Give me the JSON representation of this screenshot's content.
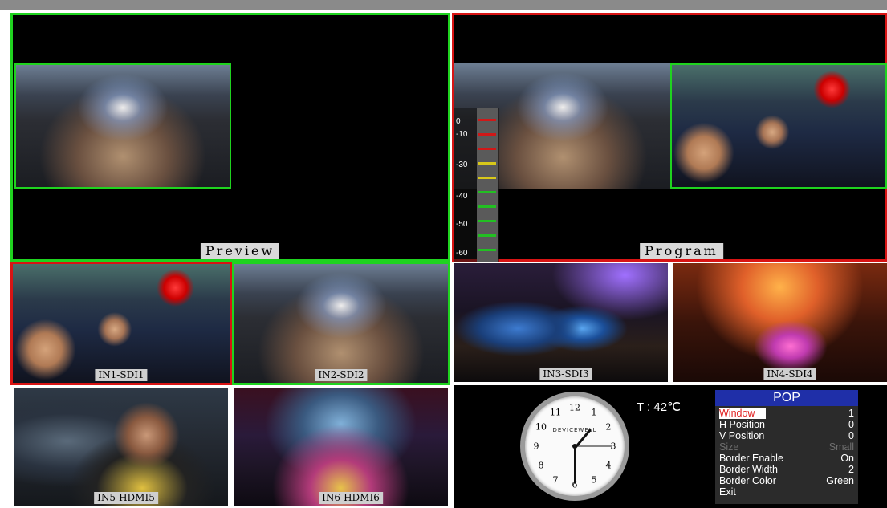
{
  "preview": {
    "label": "Preview"
  },
  "program": {
    "label": "Program"
  },
  "audio_meter": {
    "scale": [
      "0",
      "-10",
      "-30",
      "-40",
      "-50",
      "-60"
    ],
    "colors": {
      "red": "#d01818",
      "yellow": "#d8c81a",
      "green": "#22c022"
    }
  },
  "sources": [
    {
      "label": "IN1-SDI1",
      "image": "esports-players"
    },
    {
      "label": "IN2-SDI2",
      "image": "arena-crowd"
    },
    {
      "label": "IN3-SDI3",
      "image": "lan-party"
    },
    {
      "label": "IN4-SDI4",
      "image": "stage-lights"
    },
    {
      "label": "IN5-HDMI5",
      "image": "player-headset"
    },
    {
      "label": "IN6-HDMI6",
      "image": "esports-hall"
    }
  ],
  "clock": {
    "brand": "DEVICEWELL",
    "numbers": [
      "12",
      "1",
      "2",
      "3",
      "4",
      "5",
      "6",
      "7",
      "8",
      "9",
      "10",
      "11"
    ]
  },
  "temperature": "T : 42℃",
  "pop_menu": {
    "title": "POP",
    "items": [
      {
        "label": "Window",
        "value": "1",
        "selected": true,
        "disabled": false
      },
      {
        "label": "H Position",
        "value": "0",
        "selected": false,
        "disabled": false
      },
      {
        "label": "V Position",
        "value": "0",
        "selected": false,
        "disabled": false
      },
      {
        "label": "Size",
        "value": "Small",
        "selected": false,
        "disabled": true
      },
      {
        "label": "Border Enable",
        "value": "On",
        "selected": false,
        "disabled": false
      },
      {
        "label": "Border Width",
        "value": "2",
        "selected": false,
        "disabled": false
      },
      {
        "label": "Border Color",
        "value": "Green",
        "selected": false,
        "disabled": false
      },
      {
        "label": "Exit",
        "value": "",
        "selected": false,
        "disabled": false
      }
    ]
  },
  "colors": {
    "preview_border": "#1fd31f",
    "program_border": "#d81414",
    "menu_header": "#1f2fa8",
    "menu_selected": "#ffffff"
  }
}
